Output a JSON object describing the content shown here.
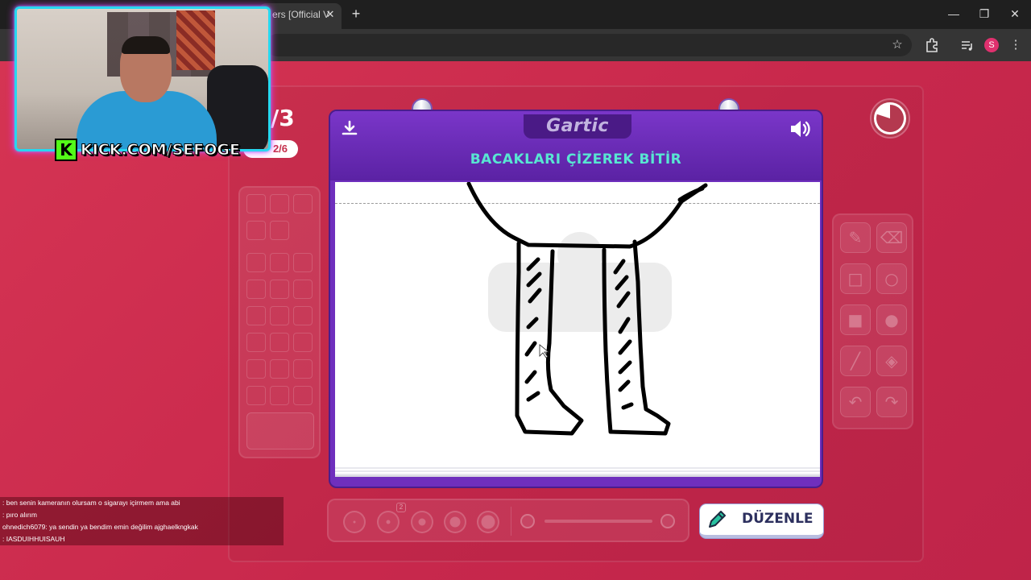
{
  "browser": {
    "tab_title": "ers [Official V",
    "tab_close": "✕",
    "new_tab": "+",
    "window_minimize": "—",
    "window_restore": "❐",
    "window_close": "✕",
    "profile_initial": "S"
  },
  "webcam": {
    "kick_logo": "K",
    "kick_url": "KICK.COM/SEFOGE"
  },
  "game": {
    "round_number": "/3",
    "round_progress": "2/6",
    "logo": "Gartic",
    "prompt": "BACAKLARI ÇİZEREK BİTİR",
    "timer_remaining_fraction": 0.2,
    "edit_button": "DÜZENLE",
    "brush_size_badge": "2"
  },
  "tools": [
    "pencil-icon",
    "eraser-icon",
    "rectangle-outline-icon",
    "ellipse-outline-icon",
    "rectangle-filled-icon",
    "ellipse-filled-icon",
    "line-icon",
    "fill-bucket-icon",
    "undo-icon",
    "redo-icon"
  ],
  "chat": [
    {
      "user": "",
      "text": ": ben senin kameranın olursam o sigarayı içirmem ama abi"
    },
    {
      "user": "",
      "text": ": pıro alırım"
    },
    {
      "user": "ohnedich6079",
      "text": ": ya sendin ya bendim emin değilim ajghaelkngkak"
    },
    {
      "user": "",
      "text": ": IASDUIHHUISAUH"
    }
  ],
  "colors": {
    "background": "#d63a56",
    "board_purple": "#6f2fbd",
    "prompt_teal": "#58e6d2",
    "webcam_border": "#27d7f0",
    "kick_green": "#53fc18"
  }
}
